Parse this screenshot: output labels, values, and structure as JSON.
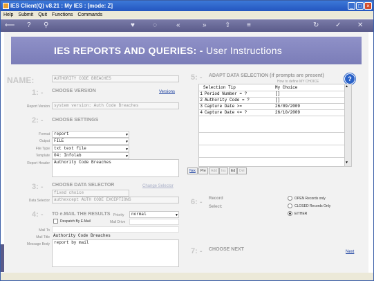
{
  "window": {
    "title": "IES Client(Q) v8.21 : My IES :        [mode: Z]"
  },
  "menu": [
    "Help",
    "Submit",
    "Quit",
    "Functions",
    "Commands"
  ],
  "banner": {
    "title": "IES REPORTS AND QUERIES: -",
    "subtitle": "User Instructions"
  },
  "name": {
    "label": "NAME:",
    "value": "AUTHORITY CODE BREACHES"
  },
  "version": {
    "step": "1: -",
    "title": "CHOOSE VERSION",
    "link": "Versions",
    "label": "Report Version",
    "value": "system version: Auth Code Breaches"
  },
  "settings": {
    "step": "2: -",
    "title": "CHOOSE SETTINGS",
    "format": {
      "label": "Format",
      "value": "report"
    },
    "output": {
      "label": "Output",
      "value": "FILE"
    },
    "filetype": {
      "label": "File Type",
      "value": "txt text file"
    },
    "template": {
      "label": "Template",
      "value": "04: Infolab"
    },
    "header": {
      "label": "Report Header",
      "value": "Authority Code Breaches"
    }
  },
  "selector": {
    "step": "3: -",
    "title": "CHOOSE DATA SELECTOR",
    "link": "Change Selector",
    "fixed": "fixed choice",
    "label": "Data Selector",
    "value": "authexcept AUTH CODE EXCEPTIONS"
  },
  "mail": {
    "step": "4: -",
    "title": "TO e.MAIL THE RESULTS",
    "priority_label": "Priority",
    "priority": "normal",
    "despatch": "Despatch By E-Mail",
    "mail_drive": "Mail Drive",
    "to_label": "Mail To",
    "title_label": "Mail Title",
    "title_value": "Authority Code Breaches",
    "body_label": "Message Body",
    "body_value": "report by mail"
  },
  "adapt": {
    "step": "5: -",
    "title": "ADAPT DATA SELECTION (if prompts are present)",
    "howto": "How to define MY CHOICE",
    "col_tip": "Selection Tip",
    "col_choice": "My Choice",
    "rows": [
      {
        "n": "1",
        "tip": "Period Number = ?",
        "choice": "[]"
      },
      {
        "n": "2",
        "tip": "Authority Code = ?",
        "choice": "[]"
      },
      {
        "n": "3",
        "tip": "Capture Date >=",
        "choice": "26/09/2009"
      },
      {
        "n": "4",
        "tip": "Capture Date <= ?",
        "choice": "26/10/2009"
      }
    ],
    "buttons": [
      "Nex",
      "Pre",
      "Add",
      "Ins",
      "Ed",
      "Del"
    ]
  },
  "record": {
    "step": "6: -",
    "title": "Record",
    "select": "Select:",
    "opt1": "OPEN Records only",
    "opt2": "CLOSED Records Only",
    "opt3": "EITHER"
  },
  "next": {
    "step": "7: -",
    "title": "CHOOSE NEXT",
    "link": "Next"
  }
}
